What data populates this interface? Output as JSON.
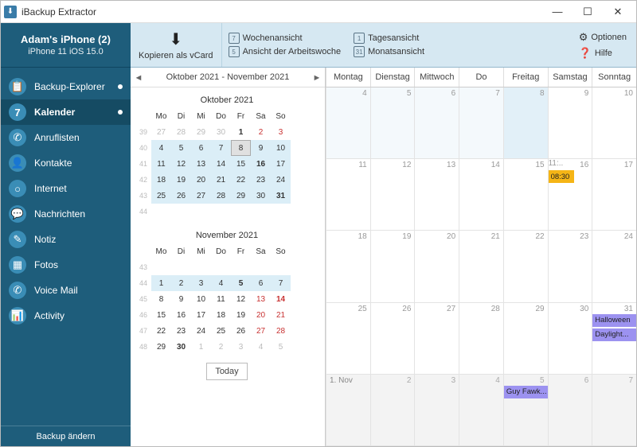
{
  "app": {
    "title": "iBackup Extractor"
  },
  "window_buttons": {
    "min": "—",
    "max": "☐",
    "close": "✕"
  },
  "device": {
    "name": "Adam's iPhone (2)",
    "subtitle": "iPhone 11 iOS 15.0"
  },
  "sidebar": {
    "items": [
      {
        "label": "Backup-Explorer",
        "glyph": "📋",
        "active": false,
        "dot": true
      },
      {
        "label": "Kalender",
        "glyph": "7",
        "active": true,
        "dot": true
      },
      {
        "label": "Anruflisten",
        "glyph": "✆",
        "active": false,
        "dot": false
      },
      {
        "label": "Kontakte",
        "glyph": "👤",
        "active": false,
        "dot": false
      },
      {
        "label": "Internet",
        "glyph": "○",
        "active": false,
        "dot": false
      },
      {
        "label": "Nachrichten",
        "glyph": "💬",
        "active": false,
        "dot": false
      },
      {
        "label": "Notiz",
        "glyph": "✎",
        "active": false,
        "dot": false
      },
      {
        "label": "Fotos",
        "glyph": "▦",
        "active": false,
        "dot": false
      },
      {
        "label": "Voice Mail",
        "glyph": "✆",
        "active": false,
        "dot": false
      },
      {
        "label": "Activity",
        "glyph": "📊",
        "active": false,
        "dot": false
      }
    ],
    "footer": "Backup ändern"
  },
  "toolbar": {
    "copy_vcard": "Kopieren als vCard",
    "week_view": "Wochenansicht",
    "workweek_view": "Ansicht der Arbeitswoche",
    "day_view": "Tagesansicht",
    "month_view": "Monatsansicht",
    "options": "Optionen",
    "help": "Hilfe"
  },
  "range_header": "Oktober 2021 - November 2021",
  "today_button": "Today",
  "weekdays_short": [
    "Mo",
    "Di",
    "Mi",
    "Do",
    "Fr",
    "Sa",
    "So"
  ],
  "minical": [
    {
      "title": "Oktober 2021",
      "weeks": [
        39,
        40,
        41,
        42,
        43,
        44
      ],
      "rows": [
        [
          {
            "d": 27,
            "g": 1
          },
          {
            "d": 28,
            "g": 1
          },
          {
            "d": 29,
            "g": 1
          },
          {
            "d": 30,
            "g": 1
          },
          {
            "d": 1,
            "b": 1
          },
          {
            "d": 2,
            "r": 1
          },
          {
            "d": 3,
            "r": 1
          }
        ],
        [
          {
            "d": 4,
            "hl": 1
          },
          {
            "d": 5,
            "hl": 1
          },
          {
            "d": 6,
            "hl": 1
          },
          {
            "d": 7,
            "hl": 1
          },
          {
            "d": 8,
            "hl": 1,
            "today": 1
          },
          {
            "d": 9,
            "hl": 1
          },
          {
            "d": 10,
            "hl": 1
          }
        ],
        [
          {
            "d": 11,
            "hl": 1
          },
          {
            "d": 12,
            "hl": 1
          },
          {
            "d": 13,
            "hl": 1
          },
          {
            "d": 14,
            "hl": 1
          },
          {
            "d": 15,
            "hl": 1
          },
          {
            "d": 16,
            "hl": 1,
            "b": 1
          },
          {
            "d": 17,
            "hl": 1
          }
        ],
        [
          {
            "d": 18,
            "hl": 1
          },
          {
            "d": 19,
            "hl": 1
          },
          {
            "d": 20,
            "hl": 1
          },
          {
            "d": 21,
            "hl": 1
          },
          {
            "d": 22,
            "hl": 1
          },
          {
            "d": 23,
            "hl": 1
          },
          {
            "d": 24,
            "hl": 1
          }
        ],
        [
          {
            "d": 25,
            "hl": 1
          },
          {
            "d": 26,
            "hl": 1
          },
          {
            "d": 27,
            "hl": 1
          },
          {
            "d": 28,
            "hl": 1
          },
          {
            "d": 29,
            "hl": 1
          },
          {
            "d": 30,
            "hl": 1
          },
          {
            "d": 31,
            "hl": 1,
            "b": 1
          }
        ],
        [
          {
            "d": "",
            "e": 1
          },
          {
            "d": "",
            "e": 1
          },
          {
            "d": "",
            "e": 1
          },
          {
            "d": "",
            "e": 1
          },
          {
            "d": "",
            "e": 1
          },
          {
            "d": "",
            "e": 1
          },
          {
            "d": "",
            "e": 1
          }
        ]
      ]
    },
    {
      "title": "November 2021",
      "weeks": [
        43,
        44,
        45,
        46,
        47,
        48
      ],
      "rows": [
        [
          {
            "d": "",
            "e": 1
          },
          {
            "d": "",
            "e": 1
          },
          {
            "d": "",
            "e": 1
          },
          {
            "d": "",
            "e": 1
          },
          {
            "d": "",
            "e": 1
          },
          {
            "d": "",
            "e": 1
          },
          {
            "d": "",
            "e": 1
          }
        ],
        [
          {
            "d": 1,
            "hl": 1
          },
          {
            "d": 2,
            "hl": 1
          },
          {
            "d": 3,
            "hl": 1
          },
          {
            "d": 4,
            "hl": 1
          },
          {
            "d": 5,
            "hl": 1,
            "b": 1
          },
          {
            "d": 6,
            "hl": 1
          },
          {
            "d": 7,
            "hl": 1
          }
        ],
        [
          {
            "d": 8
          },
          {
            "d": 9
          },
          {
            "d": 10
          },
          {
            "d": 11
          },
          {
            "d": 12
          },
          {
            "d": 13,
            "r": 1
          },
          {
            "d": 14,
            "r": 1,
            "b": 1
          }
        ],
        [
          {
            "d": 15
          },
          {
            "d": 16
          },
          {
            "d": 17
          },
          {
            "d": 18
          },
          {
            "d": 19
          },
          {
            "d": 20,
            "r": 1
          },
          {
            "d": 21,
            "r": 1
          }
        ],
        [
          {
            "d": 22
          },
          {
            "d": 23
          },
          {
            "d": 24
          },
          {
            "d": 25
          },
          {
            "d": 26
          },
          {
            "d": 27,
            "r": 1
          },
          {
            "d": 28,
            "r": 1
          }
        ],
        [
          {
            "d": 29
          },
          {
            "d": 30,
            "b": 1
          },
          {
            "d": 1,
            "g": 1
          },
          {
            "d": 2,
            "g": 1
          },
          {
            "d": 3,
            "g": 1
          },
          {
            "d": 4,
            "g": 1
          },
          {
            "d": 5,
            "g": 1
          }
        ]
      ]
    }
  ],
  "monthview": {
    "headers": [
      "Montag",
      "Dienstag",
      "Mittwoch",
      "Do",
      "Freitag",
      "Samstag",
      "Sonntag"
    ],
    "cells": [
      [
        {
          "n": 4,
          "sel": 1
        },
        {
          "n": 5,
          "sel": 1
        },
        {
          "n": 6,
          "sel": 1
        },
        {
          "n": 7,
          "sel": 1
        },
        {
          "n": 8,
          "today": 1
        },
        {
          "n": 9
        },
        {
          "n": 10
        }
      ],
      [
        {
          "n": 11
        },
        {
          "n": 12
        },
        {
          "n": 13
        },
        {
          "n": 14
        },
        {
          "n": 15
        },
        {
          "n": 16,
          "ev": [
            {
              "t": "08:30",
              "k": "orange"
            },
            {
              "t": "11:..",
              "k": "orange2"
            }
          ]
        },
        {
          "n": 17
        }
      ],
      [
        {
          "n": 18
        },
        {
          "n": 19
        },
        {
          "n": 20
        },
        {
          "n": 21
        },
        {
          "n": 22
        },
        {
          "n": 23
        },
        {
          "n": 24
        }
      ],
      [
        {
          "n": 25
        },
        {
          "n": 26
        },
        {
          "n": 27
        },
        {
          "n": 28
        },
        {
          "n": 29
        },
        {
          "n": 30
        },
        {
          "n": 31,
          "ev": [
            {
              "t": "Halloween",
              "k": "purple"
            }
          ],
          "ev2": [
            {
              "t": "Daylight...",
              "k": "purple"
            }
          ]
        }
      ],
      [
        {
          "n": "1",
          "ml": "1. Nov",
          "gray": 1
        },
        {
          "n": 2,
          "gray": 1
        },
        {
          "n": 3,
          "gray": 1
        },
        {
          "n": 4,
          "gray": 1
        },
        {
          "n": 5,
          "gray": 1,
          "ev": [
            {
              "t": "Guy Fawk...",
              "k": "purple"
            }
          ]
        },
        {
          "n": 6,
          "gray": 1
        },
        {
          "n": 7,
          "gray": 1
        }
      ]
    ]
  }
}
